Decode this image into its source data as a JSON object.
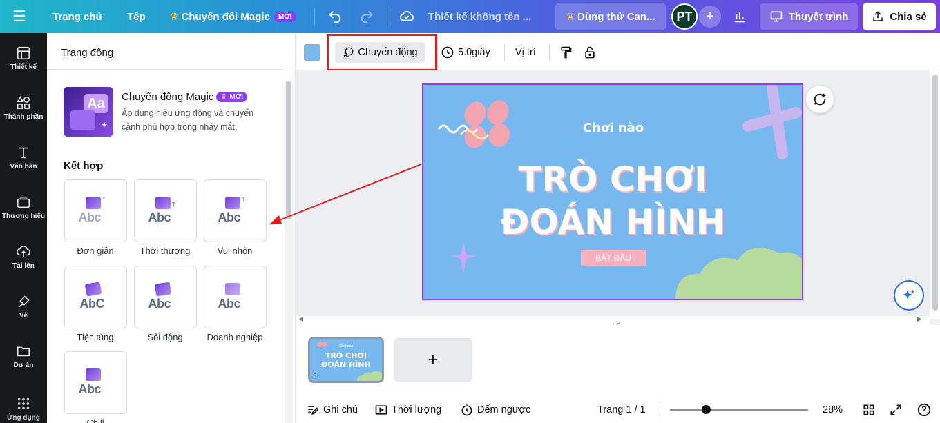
{
  "topbar": {
    "home": "Trang chủ",
    "file": "Tệp",
    "magic_switch": "Chuyển đổi Magic",
    "new_badge": "MỚI",
    "design_title": "Thiết kế không tên ...",
    "trial": "Dùng thử Can...",
    "avatar_initials": "PT",
    "present": "Thuyết trình",
    "share": "Chia sẻ"
  },
  "rail": {
    "items": [
      {
        "label": "Thiết kế",
        "icon": "layout-icon"
      },
      {
        "label": "Thành phần",
        "icon": "shapes-icon"
      },
      {
        "label": "Văn bản",
        "icon": "text-icon"
      },
      {
        "label": "Thương hiệu",
        "icon": "brand-icon"
      },
      {
        "label": "Tải lên",
        "icon": "upload-icon"
      },
      {
        "label": "Vẽ",
        "icon": "draw-icon"
      },
      {
        "label": "Dự án",
        "icon": "folder-icon"
      },
      {
        "label": "Ứng dụng",
        "icon": "apps-icon"
      }
    ]
  },
  "panel": {
    "title": "Trang động",
    "magic": {
      "title": "Chuyển động Magic",
      "badge": "MỚI",
      "desc": "Áp dụng hiệu ứng động và chuyển cảnh phù hợp trong nháy mắt.",
      "icon_text": "Aa"
    },
    "section": "Kết hợp",
    "tiles": [
      {
        "label": "Đơn giản",
        "art": "Abc"
      },
      {
        "label": "Thời thượng",
        "art": "Abc"
      },
      {
        "label": "Vui nhộn",
        "art": "Abc"
      },
      {
        "label": "Tiệc tùng",
        "art": "AbC"
      },
      {
        "label": "Sôi động",
        "art": "Abc"
      },
      {
        "label": "Doanh nghiệp",
        "art": "Abc"
      },
      {
        "label": "Chill",
        "art": "Abc"
      }
    ]
  },
  "ctx": {
    "animate": "Chuyển động",
    "duration": "5.0giây",
    "position": "Vị trí",
    "swatch_color": "#7ab8f0"
  },
  "slide": {
    "subtitle": "Chơi nào",
    "title_line1": "TRÒ CHƠI",
    "title_line2": "ĐOÁN HÌNH",
    "button": "BẮT ĐẦU"
  },
  "filmstrip": {
    "page_number": "1",
    "thumb_sub": "Chơi nào",
    "thumb_line1": "TRÒ CHƠI",
    "thumb_line2": "ĐOÁN HÌNH"
  },
  "bottom": {
    "notes": "Ghi chú",
    "duration": "Thời lượng",
    "countdown": "Đếm ngược",
    "page": "Trang 1 / 1",
    "zoom": "28%",
    "zoom_fraction": 0.28
  },
  "colors": {
    "accent": "#8b3dff",
    "slide_bg": "#77b8ee",
    "highlight": "#e31c1c"
  }
}
